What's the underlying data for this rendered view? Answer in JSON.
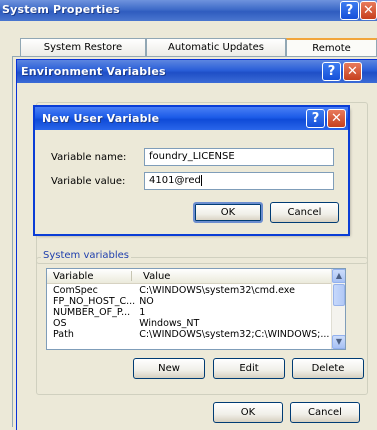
{
  "system_properties": {
    "title": "System Properties",
    "tabs": [
      "System Restore",
      "Automatic Updates",
      "Remote"
    ]
  },
  "environment_variables": {
    "title": "Environment Variables",
    "system_variables_label": "System variables",
    "columns": [
      "Variable",
      "Value"
    ],
    "rows": [
      {
        "variable": "ComSpec",
        "value": "C:\\WINDOWS\\system32\\cmd.exe"
      },
      {
        "variable": "FP_NO_HOST_C...",
        "value": "NO"
      },
      {
        "variable": "NUMBER_OF_P...",
        "value": "1"
      },
      {
        "variable": "OS",
        "value": "Windows_NT"
      },
      {
        "variable": "Path",
        "value": "C:\\WINDOWS\\system32;C:\\WINDOWS;..."
      }
    ],
    "new_label": "New",
    "edit_label": "Edit",
    "delete_label": "Delete",
    "ok_label": "OK",
    "cancel_label": "Cancel"
  },
  "new_user_variable": {
    "title": "New User Variable",
    "name_label": "Variable name:",
    "name_value": "foundry_LICENSE",
    "value_label": "Variable value:",
    "value_value": "4101@red",
    "ok_label": "OK",
    "cancel_label": "Cancel"
  },
  "colors": {
    "title_blue": "#0f4bd8",
    "dialog_bg": "#ece9d8",
    "close_red": "#c6401e"
  }
}
